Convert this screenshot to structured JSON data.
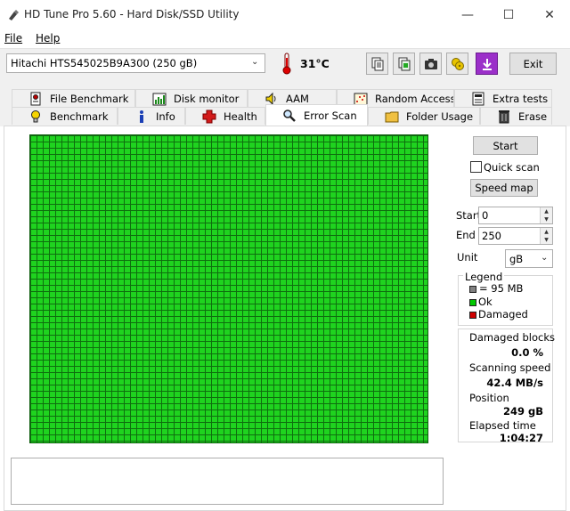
{
  "window": {
    "title": "HD Tune Pro 5.60 - Hard Disk/SSD Utility",
    "minimize": "—",
    "maximize": "☐",
    "close": "✕"
  },
  "menu": {
    "file": "File",
    "help": "Help"
  },
  "toolbar": {
    "drive": "Hitachi HTS545025B9A300 (250 gB)",
    "temperature": "31°C",
    "exit_label": "Exit",
    "icons": [
      "copy-icon",
      "copy-all-icon",
      "camera-icon",
      "disk-tools-icon",
      "download-icon"
    ]
  },
  "tabs": {
    "row1": [
      "File Benchmark",
      "Disk monitor",
      "AAM",
      "Random Access",
      "Extra tests"
    ],
    "row2": [
      "Benchmark",
      "Info",
      "Health",
      "Error Scan",
      "Folder Usage",
      "Erase"
    ],
    "active": "Error Scan"
  },
  "scan": {
    "start_label": "Start",
    "quick_scan_label": "Quick scan",
    "quick_scan_checked": false,
    "speed_map_label": "Speed map",
    "start_field_label": "Start",
    "start_value": "0",
    "end_field_label": "End",
    "end_value": "250",
    "unit_label": "Unit",
    "unit_value": "gB",
    "block_color": "#1fd31f"
  },
  "legend": {
    "title": "Legend",
    "items": [
      {
        "label": "= 95 MB",
        "color": "#808080"
      },
      {
        "label": "Ok",
        "color": "#00c800"
      },
      {
        "label": "Damaged",
        "color": "#d00000"
      }
    ]
  },
  "stats": {
    "damaged_label": "Damaged blocks",
    "damaged_value": "0.0 %",
    "speed_label": "Scanning speed",
    "speed_value": "42.4 MB/s",
    "position_label": "Position",
    "position_value": "249 gB",
    "elapsed_label": "Elapsed time",
    "elapsed_value": "1:04:27"
  }
}
